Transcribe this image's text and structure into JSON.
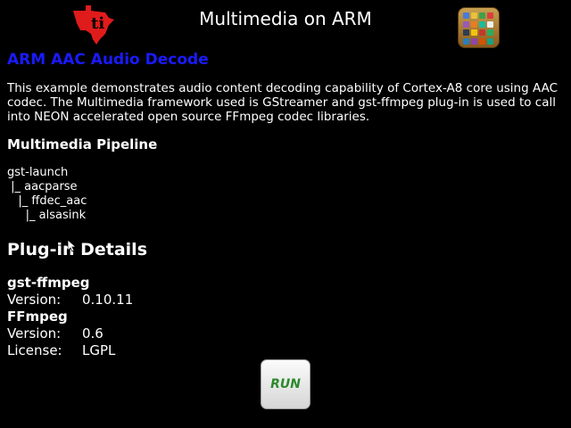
{
  "header": {
    "title": "Multimedia on ARM",
    "logo_icon": "texas-instruments-logo",
    "apps_icon": "app-grid-icon"
  },
  "content": {
    "heading": "ARM AAC Audio Decode",
    "description": "This example demonstrates audio content decoding capability of Cortex-A8 core using AAC codec. The Multimedia framework used is GStreamer and gst-ffmpeg plug-in is used to call into NEON accelerated open source FFmpeg codec libraries.",
    "pipeline_heading": "Multimedia Pipeline",
    "pipeline": [
      "gst-launch",
      " |_ aacparse",
      "   |_ ffdec_aac",
      "     |_ alsasink"
    ],
    "plugin_heading": "Plug-in Details",
    "plugins": [
      {
        "name": "gst-ffmpeg",
        "version_label": "Version:",
        "version": "0.10.11"
      },
      {
        "name": "FFmpeg",
        "version_label": "Version:",
        "version": "0.6",
        "license_label": "License:",
        "license": "LGPL"
      }
    ]
  },
  "run_button": {
    "label": "RUN"
  },
  "colors": {
    "heading": "#1a1aff",
    "logo": "#e01b1b",
    "run_text": "#2c8a2c",
    "background": "#000000"
  }
}
